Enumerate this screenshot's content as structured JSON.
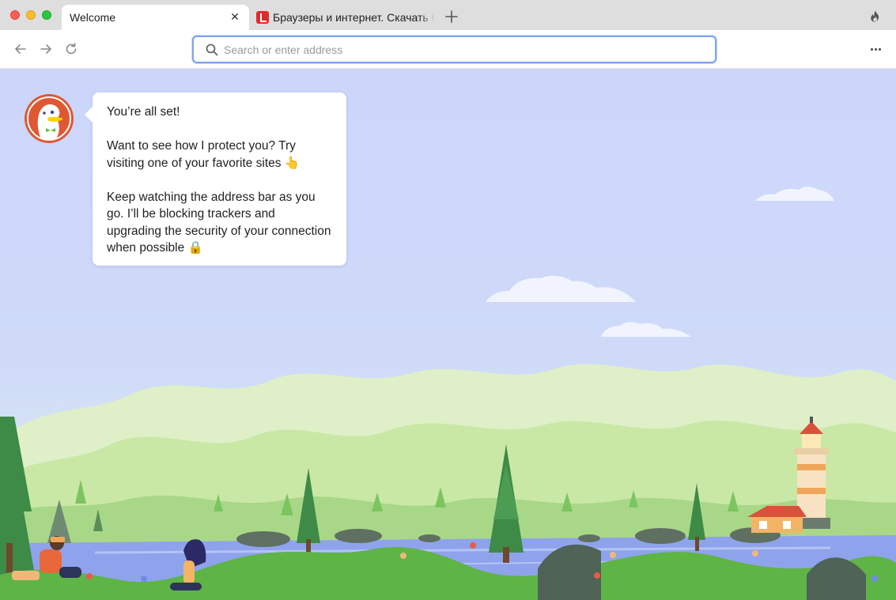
{
  "window": {
    "tabs": [
      {
        "label": "Welcome",
        "active": true
      },
      {
        "label": "Браузеры и интернет. Скачать бесплатно",
        "favicon": "red-document-icon"
      }
    ],
    "new_tab_icon": "plus-icon",
    "fire_icon": "fire-icon"
  },
  "navbar": {
    "back_icon": "arrow-left-icon",
    "forward_icon": "arrow-right-icon",
    "reload_icon": "reload-icon",
    "address": {
      "value": "",
      "placeholder": "Search or enter address"
    },
    "menu_icon": "more-horizontal-icon"
  },
  "welcome": {
    "heading": "You’re all set!",
    "paragraph_1": "Want to see how I protect you? Try visiting one of your favorite sites 👆",
    "paragraph_2": "Keep watching the address bar as you go. I’ll be blocking trackers and upgrading the security of your connection when possible 🔒"
  },
  "colors": {
    "accent": "#7ea4f2",
    "sky": "#ccd6fb",
    "dax_orange": "#de5833",
    "grass": "#5fb446"
  }
}
